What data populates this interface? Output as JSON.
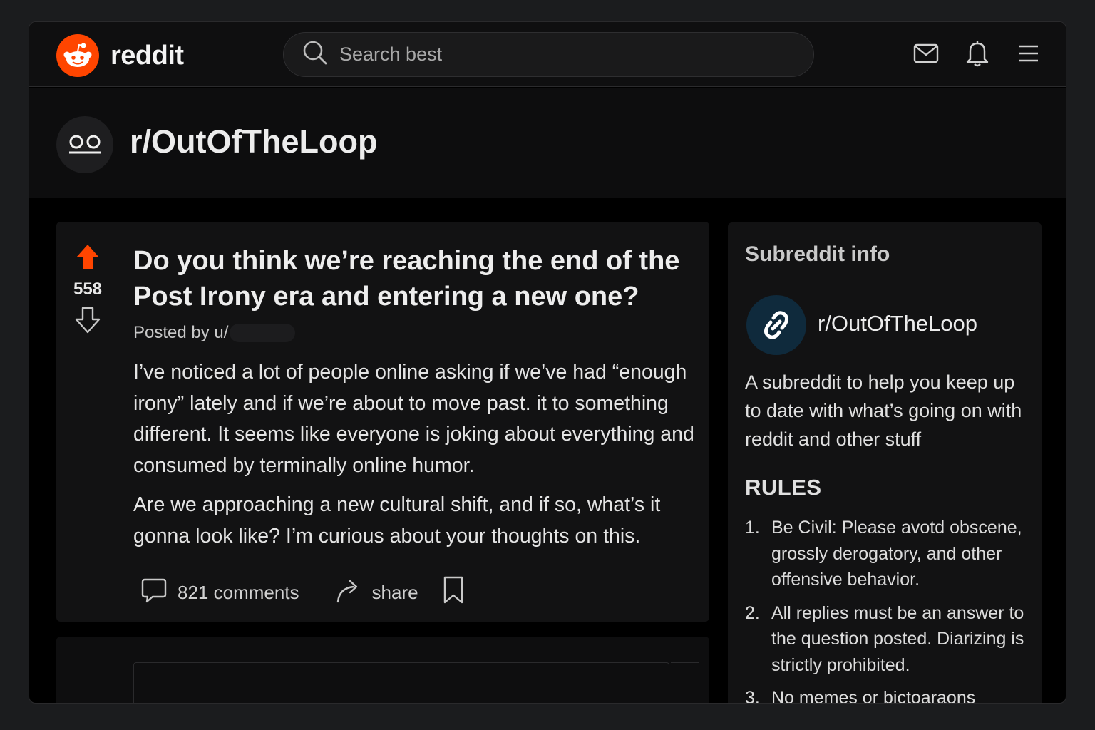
{
  "header": {
    "logo_text": "reddit",
    "search_placeholder": "Search best",
    "icons": [
      "mail-icon",
      "bell-icon",
      "menu-icon"
    ]
  },
  "subreddit": {
    "name": "r/OutOfTheLoop"
  },
  "post": {
    "votes": "558",
    "title": "Do you think we’re reaching the end of the Post Irony era and entering a new one?",
    "posted_by": "Posted by u/",
    "body": [
      "I’ve noticed a lot of people online asking if we’ve had “enough irony” lately and if we’re about to move past. it to something different. It seems like everyone is joking about everything and consumed by terminally online humor.",
      "Are we approaching a new cultural shift, and if so, what’s it gonna look like? I’m curious about your thoughts on this."
    ],
    "comments_label": "821 comments",
    "share_label": "share"
  },
  "sidebar": {
    "heading": "Subreddit info",
    "name": "r/OutOfTheLoop",
    "description": "A subreddit to help you keep up to date with what’s going on with reddit and other stuff",
    "rules_title": "RULES",
    "rules": [
      {
        "num": "1.",
        "text": "Be Civil: Please avotd obscene, grossly derogatory, and other offensive behavior."
      },
      {
        "num": "2.",
        "text": "All replies must be an answer to the question posted. Diarizing is strictly prohibited."
      },
      {
        "num": "3.",
        "text": "No memes or bictoaraons"
      }
    ]
  },
  "colors": {
    "accent": "#ff4500",
    "background": "#000000",
    "card": "#121213",
    "text": "#e6e6e6",
    "sidebar_avatar": "#0f2a3c"
  }
}
